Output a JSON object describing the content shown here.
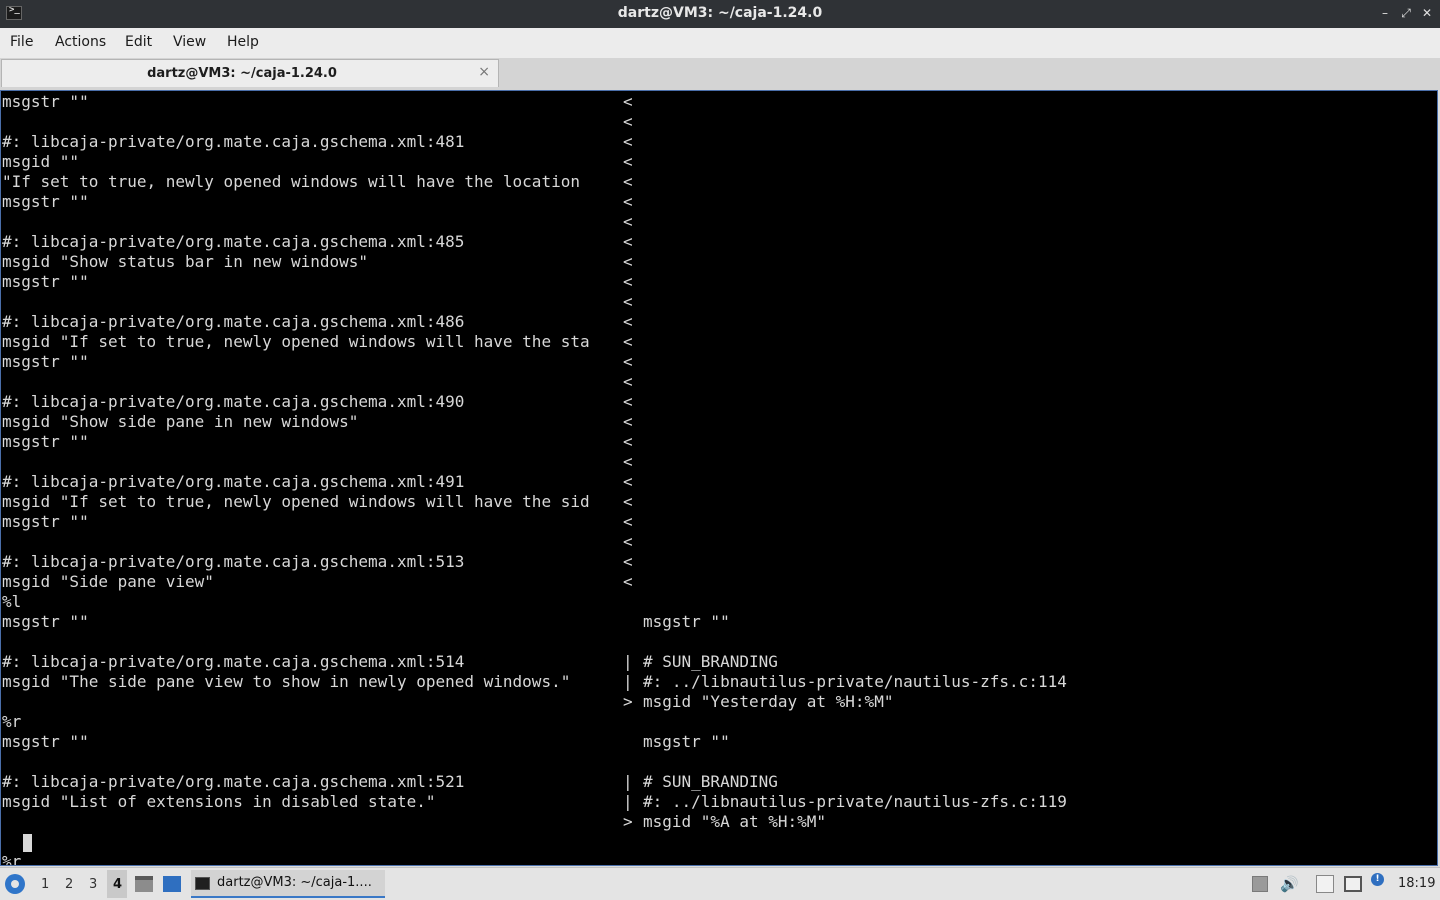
{
  "window": {
    "title": "dartz@VM3: ~/caja-1.24.0",
    "icon": "terminal-icon",
    "controls": [
      "minimize-icon",
      "maximize-icon",
      "close-icon"
    ]
  },
  "menu": {
    "file": "File",
    "actions": "Actions",
    "edit": "Edit",
    "view": "View",
    "help": "Help"
  },
  "tab": {
    "label": "dartz@VM3: ~/caja-1.24.0",
    "close": "×"
  },
  "terminal": {
    "lines": [
      {
        "l": "msgstr \"\"",
        "m": "<",
        "r": ""
      },
      {
        "l": "",
        "m": "<",
        "r": ""
      },
      {
        "l": "#: libcaja-private/org.mate.caja.gschema.xml:481",
        "m": "<",
        "r": ""
      },
      {
        "l": "msgid \"\"",
        "m": "<",
        "r": ""
      },
      {
        "l": "\"If set to true, newly opened windows will have the location",
        "m": "<",
        "r": ""
      },
      {
        "l": "msgstr \"\"",
        "m": "<",
        "r": ""
      },
      {
        "l": "",
        "m": "<",
        "r": ""
      },
      {
        "l": "#: libcaja-private/org.mate.caja.gschema.xml:485",
        "m": "<",
        "r": ""
      },
      {
        "l": "msgid \"Show status bar in new windows\"",
        "m": "<",
        "r": ""
      },
      {
        "l": "msgstr \"\"",
        "m": "<",
        "r": ""
      },
      {
        "l": "",
        "m": "<",
        "r": ""
      },
      {
        "l": "#: libcaja-private/org.mate.caja.gschema.xml:486",
        "m": "<",
        "r": ""
      },
      {
        "l": "msgid \"If set to true, newly opened windows will have the sta",
        "m": "<",
        "r": ""
      },
      {
        "l": "msgstr \"\"",
        "m": "<",
        "r": ""
      },
      {
        "l": "",
        "m": "<",
        "r": ""
      },
      {
        "l": "#: libcaja-private/org.mate.caja.gschema.xml:490",
        "m": "<",
        "r": ""
      },
      {
        "l": "msgid \"Show side pane in new windows\"",
        "m": "<",
        "r": ""
      },
      {
        "l": "msgstr \"\"",
        "m": "<",
        "r": ""
      },
      {
        "l": "",
        "m": "<",
        "r": ""
      },
      {
        "l": "#: libcaja-private/org.mate.caja.gschema.xml:491",
        "m": "<",
        "r": ""
      },
      {
        "l": "msgid \"If set to true, newly opened windows will have the sid",
        "m": "<",
        "r": ""
      },
      {
        "l": "msgstr \"\"",
        "m": "<",
        "r": ""
      },
      {
        "l": "",
        "m": "<",
        "r": ""
      },
      {
        "l": "#: libcaja-private/org.mate.caja.gschema.xml:513",
        "m": "<",
        "r": ""
      },
      {
        "l": "msgid \"Side pane view\"",
        "m": "<",
        "r": ""
      },
      {
        "l": "%l",
        "m": "",
        "r": ""
      },
      {
        "l": "msgstr \"\"",
        "m": "",
        "r": "msgstr \"\""
      },
      {
        "l": "",
        "m": "",
        "r": ""
      },
      {
        "l": "#: libcaja-private/org.mate.caja.gschema.xml:514",
        "m": "|",
        "r": "# SUN_BRANDING"
      },
      {
        "l": "msgid \"The side pane view to show in newly opened windows.\"",
        "m": "|",
        "r": "#: ../libnautilus-private/nautilus-zfs.c:114"
      },
      {
        "l": "",
        "m": ">",
        "r": "msgid \"Yesterday at %H:%M\""
      },
      {
        "l": "%r",
        "m": "",
        "r": ""
      },
      {
        "l": "msgstr \"\"",
        "m": "",
        "r": "msgstr \"\""
      },
      {
        "l": "",
        "m": "",
        "r": ""
      },
      {
        "l": "#: libcaja-private/org.mate.caja.gschema.xml:521",
        "m": "|",
        "r": "# SUN_BRANDING"
      },
      {
        "l": "msgid \"List of extensions in disabled state.\"",
        "m": "|",
        "r": "#: ../libnautilus-private/nautilus-zfs.c:119"
      },
      {
        "l": "",
        "m": ">",
        "r": "msgid \"%A at %H:%M\""
      },
      {
        "l": "",
        "m": "",
        "r": ""
      },
      {
        "l": "%r",
        "m": "",
        "r": ""
      }
    ]
  },
  "taskbar": {
    "workspaces": [
      "1",
      "2",
      "3",
      "4"
    ],
    "active_workspace": "4",
    "task_label": "dartz@VM3: ~/caja-1....",
    "clock": "18:19",
    "tray_icons": [
      "keyboard-layout-icon",
      "volume-icon",
      "clipboard-icon",
      "network-icon",
      "update-notifier-icon"
    ],
    "tray_badge": "!"
  },
  "colors": {
    "terminal_bg": "#000000",
    "terminal_fg": "#d8d8d8",
    "titlebar_bg": "#2f3236",
    "accent": "#3a78c6"
  }
}
